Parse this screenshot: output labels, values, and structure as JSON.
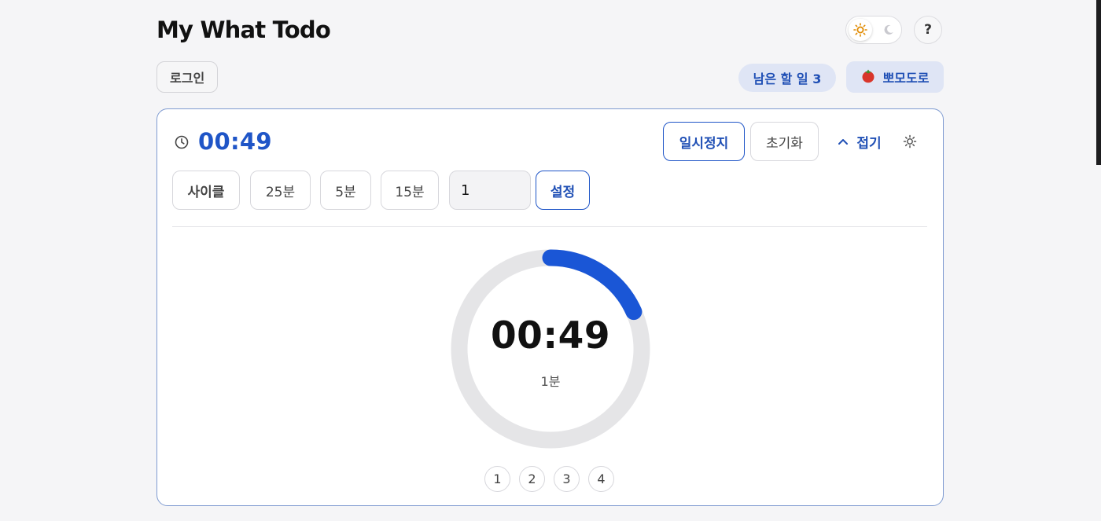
{
  "app": {
    "title": "My What Todo"
  },
  "header": {
    "theme_light_icon": "sun-icon",
    "theme_dark_icon": "moon-icon",
    "help_label": "?"
  },
  "subbar": {
    "login_label": "로그인",
    "remaining_label": "남은 할 일 3",
    "pomodoro_label": "뽀모도로",
    "pomodoro_icon": "tomato-icon"
  },
  "pomodoro": {
    "current_time": "00:49",
    "pause_label": "일시정지",
    "reset_label": "초기화",
    "collapse_label": "접기",
    "presets": [
      {
        "label": "사이클"
      },
      {
        "label": "25분"
      },
      {
        "label": "5분"
      },
      {
        "label": "15분"
      }
    ],
    "minutes_value": "1",
    "set_label": "설정",
    "ring": {
      "time": "00:49",
      "duration_label": "1분",
      "progress_fraction": 0.183,
      "track_color": "#e5e5e7",
      "progress_color": "#1a56d6"
    },
    "cycles": [
      "1",
      "2",
      "3",
      "4"
    ]
  },
  "colors": {
    "accent": "#1f55c7",
    "badge_bg": "#dfe5f5",
    "background": "#f5f5f7"
  }
}
